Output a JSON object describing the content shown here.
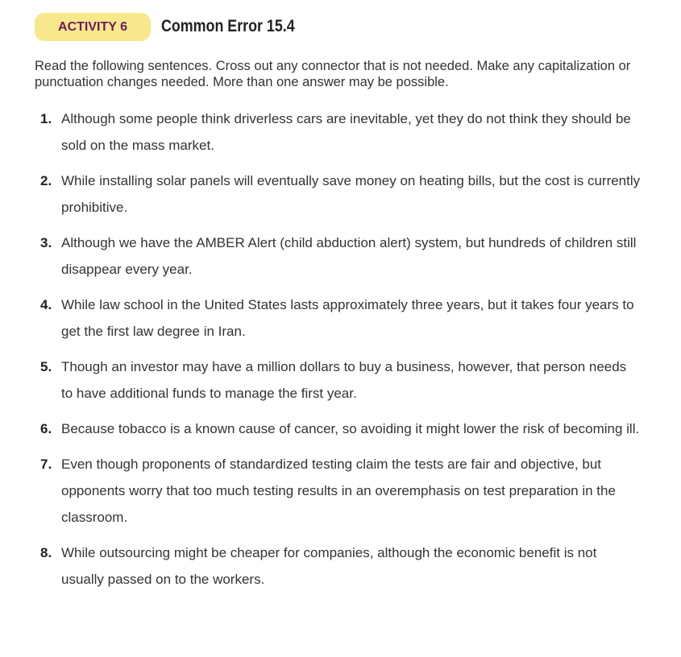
{
  "header": {
    "badge": "ACTIVITY 6",
    "title": "Common Error 15.4"
  },
  "instructions": "Read the following sentences. Cross out any connector that is not needed. Make any capitalization or punctuation changes needed. More than one answer may be possible.",
  "items": [
    {
      "num": "1.",
      "text": "Although some people think driverless cars are inevitable, yet they do not think they should be sold on the mass market."
    },
    {
      "num": "2.",
      "text": "While installing solar panels will eventually save money on heating bills, but the cost is currently prohibitive."
    },
    {
      "num": "3.",
      "text": "Although we have the AMBER Alert (child abduction alert) system, but hundreds of children still disappear every year."
    },
    {
      "num": "4.",
      "text": "While law school in the United States lasts approximately three years, but it takes four years to get the first law degree in Iran."
    },
    {
      "num": "5.",
      "text": "Though an investor may have a million dollars to buy a business, however, that person needs to have additional funds to manage the first year."
    },
    {
      "num": "6.",
      "text": "Because tobacco is a known cause of cancer, so avoiding it might lower the risk of becoming ill."
    },
    {
      "num": "7.",
      "text": "Even though proponents of standardized testing claim the tests are fair and objective, but opponents worry that too much testing results in an overemphasis on test preparation in the classroom."
    },
    {
      "num": "8.",
      "text": "While outsourcing might be cheaper for companies, although the economic benefit is not usually passed on to the workers."
    }
  ]
}
